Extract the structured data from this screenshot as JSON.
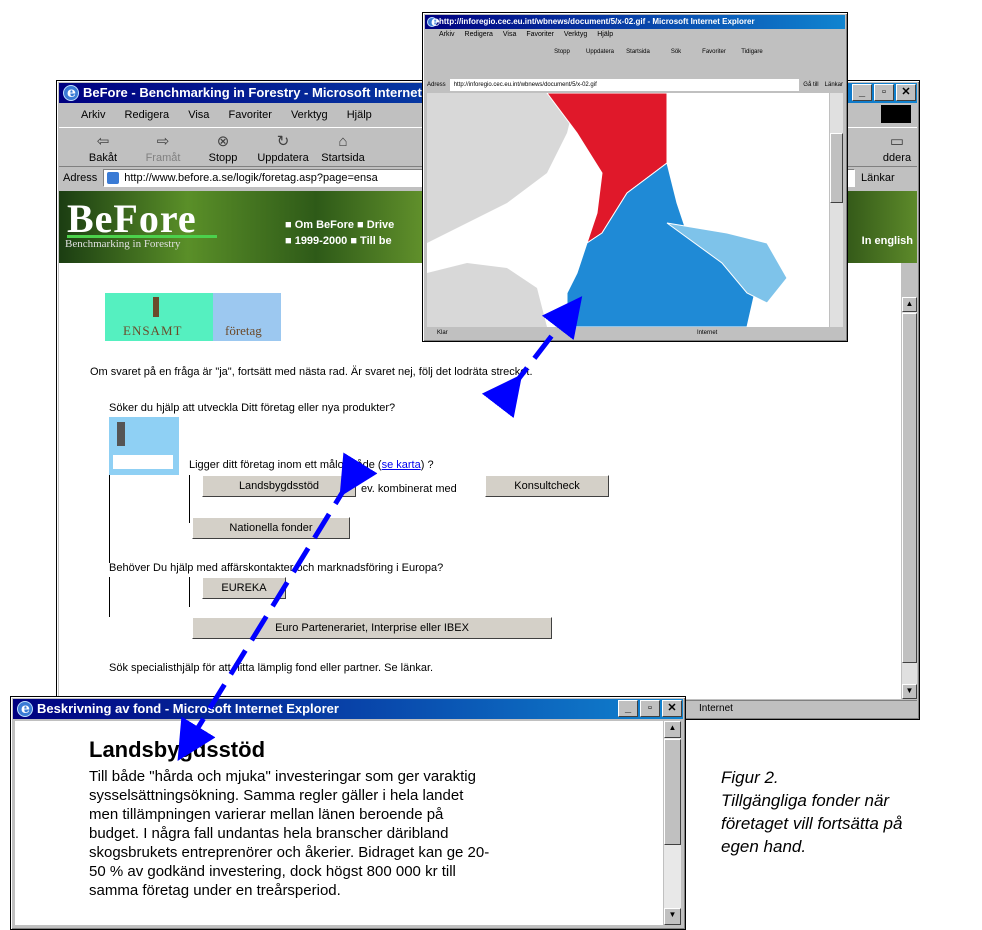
{
  "main_window": {
    "title": "BeFore - Benchmarking in Forestry - Microsoft Internet",
    "menu": [
      "Arkiv",
      "Redigera",
      "Visa",
      "Favoriter",
      "Verktyg",
      "Hjälp"
    ],
    "toolbar": {
      "back": "Bakåt",
      "forward": "Framåt",
      "stop": "Stopp",
      "refresh": "Uppdatera",
      "home": "Startsida",
      "partial": "ddera"
    },
    "address_label": "Adress",
    "address": "http://www.before.a.se/logik/foretag.asp?page=ensa",
    "links_label": "Länkar",
    "banner": {
      "logo": "BeFore",
      "logo_sub": "Benchmarking in Forestry",
      "nav1": "■ Om BeFore  ■ Drive",
      "nav2": "■ 1999-2000  ■ Till be",
      "english": "In english"
    },
    "tabs": {
      "ensamt": "ENSAMT",
      "foretag": "företag"
    },
    "intro": "Om svaret på en fråga är \"ja\", fortsätt med nästa rad. Är svaret nej, följ det lodräta strecket.",
    "q1": "Söker du hjälp att utveckla Ditt företag eller nya produkter?",
    "q2_prefix": "Ligger ditt företag inom ett målområde (",
    "q2_link": "se karta",
    "q2_suffix": ") ?",
    "btn_landsbygd": "Landsbygdsstöd",
    "combined": "ev. kombinerat med",
    "btn_konsult": "Konsultcheck",
    "btn_nationella": "Nationella fonder",
    "q3": "Behöver Du hjälp med affärskontakter och marknadsföring i Europa?",
    "btn_eureka": "EUREKA",
    "btn_euro": "Euro Partenerariet, Interprise eller IBEX",
    "q4": "Sök specialisthjälp för att hitta lämplig fond eller partner. Se länkar.",
    "status": "Internet"
  },
  "map_window": {
    "title": "http://inforegio.cec.eu.int/wbnews/document/5/x-02.gif - Microsoft Internet Explorer",
    "menu": [
      "Arkiv",
      "Redigera",
      "Visa",
      "Favoriter",
      "Verktyg",
      "Hjälp"
    ],
    "toolbar": [
      "Stopp",
      "Uppdatera",
      "Startsida",
      "Sök",
      "Favoriter",
      "Tidigare"
    ],
    "address_label": "Adress",
    "address": "http://inforegio.cec.eu.int/wbnews/document/5/x-02.gif",
    "go": "Gå till",
    "links": "Länkar",
    "status_left": "Klar",
    "status_right": "Internet"
  },
  "dialog": {
    "title": "Beskrivning av fond - Microsoft Internet Explorer",
    "heading": "Landsbygdsstöd",
    "lines": [
      "Till både \"hårda och mjuka\" investeringar som ger varaktig",
      "sysselsättningsökning. Samma regler gäller i hela landet",
      "men tillämpningen varierar mellan länen beroende på",
      "budget. I några fall undantas hela branscher däribland",
      "skogsbrukets entreprenörer och åkerier. Bidraget kan ge 20-",
      "50 % av godkänd investering, dock högst 800 000 kr till",
      "samma företag under en treårsperiod."
    ]
  },
  "caption": [
    "Figur 2.",
    "Tillgängliga fonder när",
    "företaget vill fortsätta på",
    "egen hand."
  ],
  "colors": {
    "titlebar": "#000080",
    "arrow": "#0000ff",
    "map_red": "#e0182a",
    "map_blue": "#1f8ad6",
    "map_light_blue": "#7ec3ea"
  }
}
